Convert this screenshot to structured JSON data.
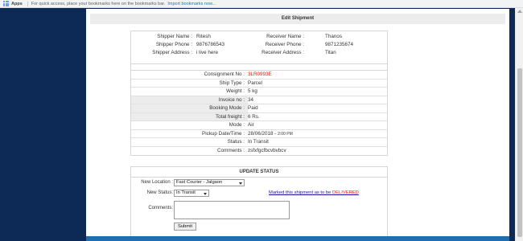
{
  "bookmarks_bar": {
    "apps_label": "Apps",
    "hint_text": "For quick access, place your bookmarks here on the bookmarks bar.",
    "import_link": "Import bookmarks now..."
  },
  "page": {
    "title": "Edit Shipment"
  },
  "shipper": {
    "name_label": "Shipper Name :",
    "name": "Ritesh",
    "phone_label": "Shipper Phone :",
    "phone": "9876786543",
    "address_label": "Shipper Address :",
    "address": "i live here"
  },
  "receiver": {
    "name_label": "Receiver Name :",
    "name": "Thanos",
    "phone_label": "Receiver Phone :",
    "phone": "9871235674",
    "address_label": "Receiver Address :",
    "address": "Titan"
  },
  "details": [
    {
      "label": "Consignment No :",
      "value": "3LR0993E"
    },
    {
      "label": "Ship Type :",
      "value": "Parcel"
    },
    {
      "label": "Weight :",
      "value": "5 kg"
    },
    {
      "label": "Invoice no :",
      "value": "34"
    },
    {
      "label": "Booking Mode :",
      "value": "Paid"
    },
    {
      "label": "Total freight :",
      "value": "6 Rs."
    },
    {
      "label": "Mode :",
      "value": "Air"
    },
    {
      "label": "Pickup Date/Time :",
      "value": "28/06/2018 -",
      "value_time": "2:00 PM"
    },
    {
      "label": "Status :",
      "value": "In Transit"
    },
    {
      "label": "Comments :",
      "value": "zsfxfgcfbcvbvbcv"
    }
  ],
  "update_status": {
    "title": "UPDATE STATUS",
    "location_label": "New Location :",
    "location_value": "Fast Courier - Jalgaon",
    "status_label": "New Status:",
    "status_value": "In Transit",
    "delivered_link_prefix": "Marked this shipment as to be",
    "delivered_link_word": "DELIVERED",
    "comments_label": "Comments:",
    "submit_label": "Submit"
  },
  "colors": {
    "background": "#0d2a57",
    "accent_red": "#e01919",
    "link_blue": "#1a0dab"
  }
}
